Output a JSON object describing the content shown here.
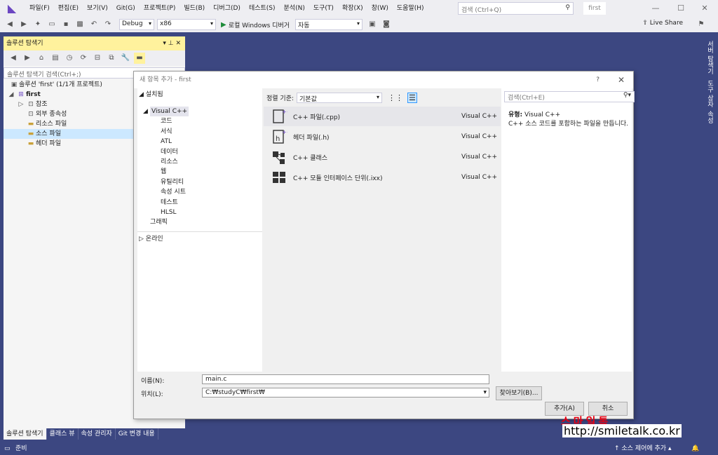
{
  "menu": [
    "파일(F)",
    "편집(E)",
    "보기(V)",
    "Git(G)",
    "프로젝트(P)",
    "빌드(B)",
    "디버그(D)",
    "테스트(S)",
    "분석(N)",
    "도구(T)",
    "확장(X)",
    "창(W)",
    "도움말(H)"
  ],
  "search_placeholder": "검색 (Ctrl+Q)",
  "project_name": "first",
  "toolbar": {
    "config": "Debug",
    "platform": "x86",
    "run_label": "로컬 Windows 디버거",
    "run_mode": "자동",
    "live_share": "Live Share"
  },
  "solution_explorer": {
    "title": "솔루션 탐색기",
    "search_placeholder": "솔루션 탐색기 검색(Ctrl+;)",
    "tree": [
      {
        "label": "솔루션 'first' (1/1개 프로젝트)",
        "indent": 0
      },
      {
        "label": "first",
        "indent": 1
      },
      {
        "label": "참조",
        "indent": 2
      },
      {
        "label": "외부 종속성",
        "indent": 2
      },
      {
        "label": "리소스 파일",
        "indent": 2
      },
      {
        "label": "소스 파일",
        "indent": 2
      },
      {
        "label": "헤더 파일",
        "indent": 2
      }
    ],
    "selected_index": 5
  },
  "bottom_tabs": [
    "솔루션 탐색기",
    "클래스 뷰",
    "속성 관리자",
    "Git 변경 내용"
  ],
  "right_tabs": [
    "서버 탐색기",
    "도구 상자",
    "속성"
  ],
  "status": {
    "left": "준비",
    "right": "소스 제어에 추가"
  },
  "dialog": {
    "title": "새 항목 추가 - first",
    "help": "?",
    "installed": "설치됨",
    "categories": [
      "Visual C++",
      "코드",
      "서식",
      "ATL",
      "데이터",
      "리소스",
      "웹",
      "유틸리티",
      "속성 시트",
      "테스트",
      "HLSL",
      "그래픽"
    ],
    "online": "온라인",
    "sort_label": "정렬 기준:",
    "sort_value": "기본값",
    "templates": [
      {
        "name": "C++ 파일(.cpp)",
        "lang": "Visual C++"
      },
      {
        "name": "헤더 파일(.h)",
        "lang": "Visual C++"
      },
      {
        "name": "C++ 클래스",
        "lang": "Visual C++"
      },
      {
        "name": "C++ 모듈 인터페이스 단위(.ixx)",
        "lang": "Visual C++"
      }
    ],
    "search_placeholder": "검색(Ctrl+E)",
    "type_label": "유형:",
    "type_value": "Visual C++",
    "description": "C++ 소스 코드를 포함하는 파일을 만듭니다.",
    "name_label": "이름(N):",
    "name_value": "main.c",
    "location_label": "위치(L):",
    "location_value": "C:₩studyC₩first₩",
    "browse_button": "찾아보기(B)...",
    "add_button": "추가(A)",
    "cancel_button": "취소"
  },
  "watermark": {
    "brand": "스마일톡",
    "url": "http://smiletalk.co.kr"
  }
}
